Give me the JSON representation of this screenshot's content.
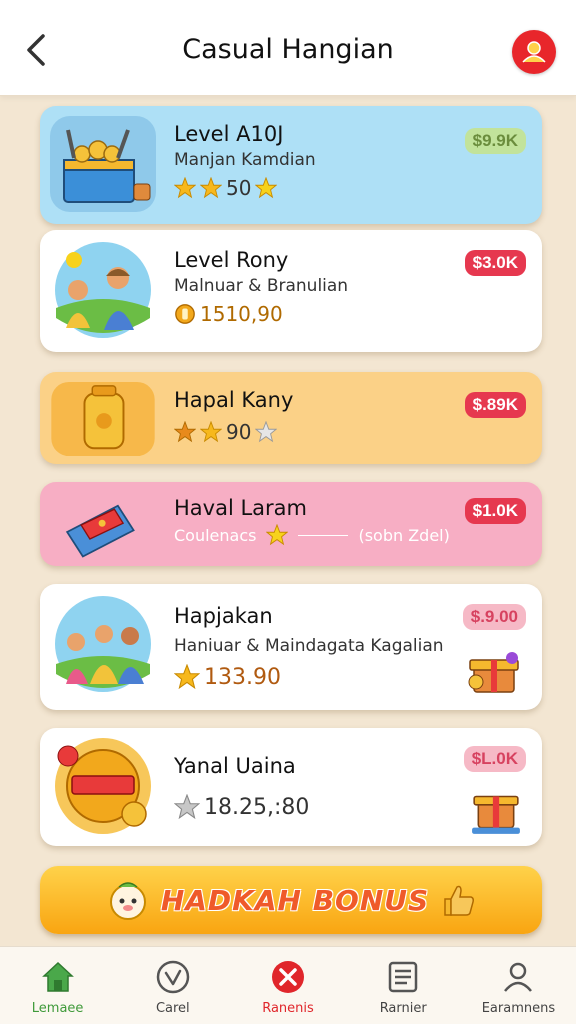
{
  "header": {
    "title": "Casual Hangian",
    "back_icon": "chevron-left-icon",
    "profile_icon": "user-badge-icon"
  },
  "cards": [
    {
      "title": "Level A10J",
      "subtitle": "Manjan Kamdian",
      "meta": "50",
      "price": "$9.9K",
      "theme": "blue"
    },
    {
      "title": "Level Rony",
      "subtitle": "Malnuar & Branulian",
      "meta": "1510,90",
      "price": "$3.0K",
      "theme": "white"
    },
    {
      "title": "Hapal Kany",
      "subtitle": "",
      "meta": "90",
      "price": "$.89K",
      "theme": "orange"
    },
    {
      "title": "Haval Laram",
      "subtitle": "Coulenacs",
      "subtitle_extra": "(sobn Zdel)",
      "price": "$1.0K",
      "theme": "pink"
    },
    {
      "title": "Hapjakan",
      "subtitle": "Haniuar & Maindagata Kagalian",
      "meta": "133.90",
      "price": "$.9.00",
      "theme": "white"
    },
    {
      "title": "Yanal Uaina",
      "subtitle": "",
      "meta": "18.25,:80",
      "price": "$L.0K",
      "theme": "white"
    }
  ],
  "bonus": {
    "label": "HADKAH BONUS"
  },
  "nav": [
    {
      "label": "Lemaee",
      "icon": "home-icon"
    },
    {
      "label": "Carel",
      "icon": "check-circle-icon"
    },
    {
      "label": "Ranenis",
      "icon": "close-circle-icon"
    },
    {
      "label": "Rarnier",
      "icon": "list-icon"
    },
    {
      "label": "Earamnens",
      "icon": "user-icon"
    }
  ],
  "colors": {
    "accent_red": "#e8262b",
    "home_green": "#3f9a3a",
    "bonus_orange": "#f9a511",
    "background": "#f3e6d2"
  }
}
